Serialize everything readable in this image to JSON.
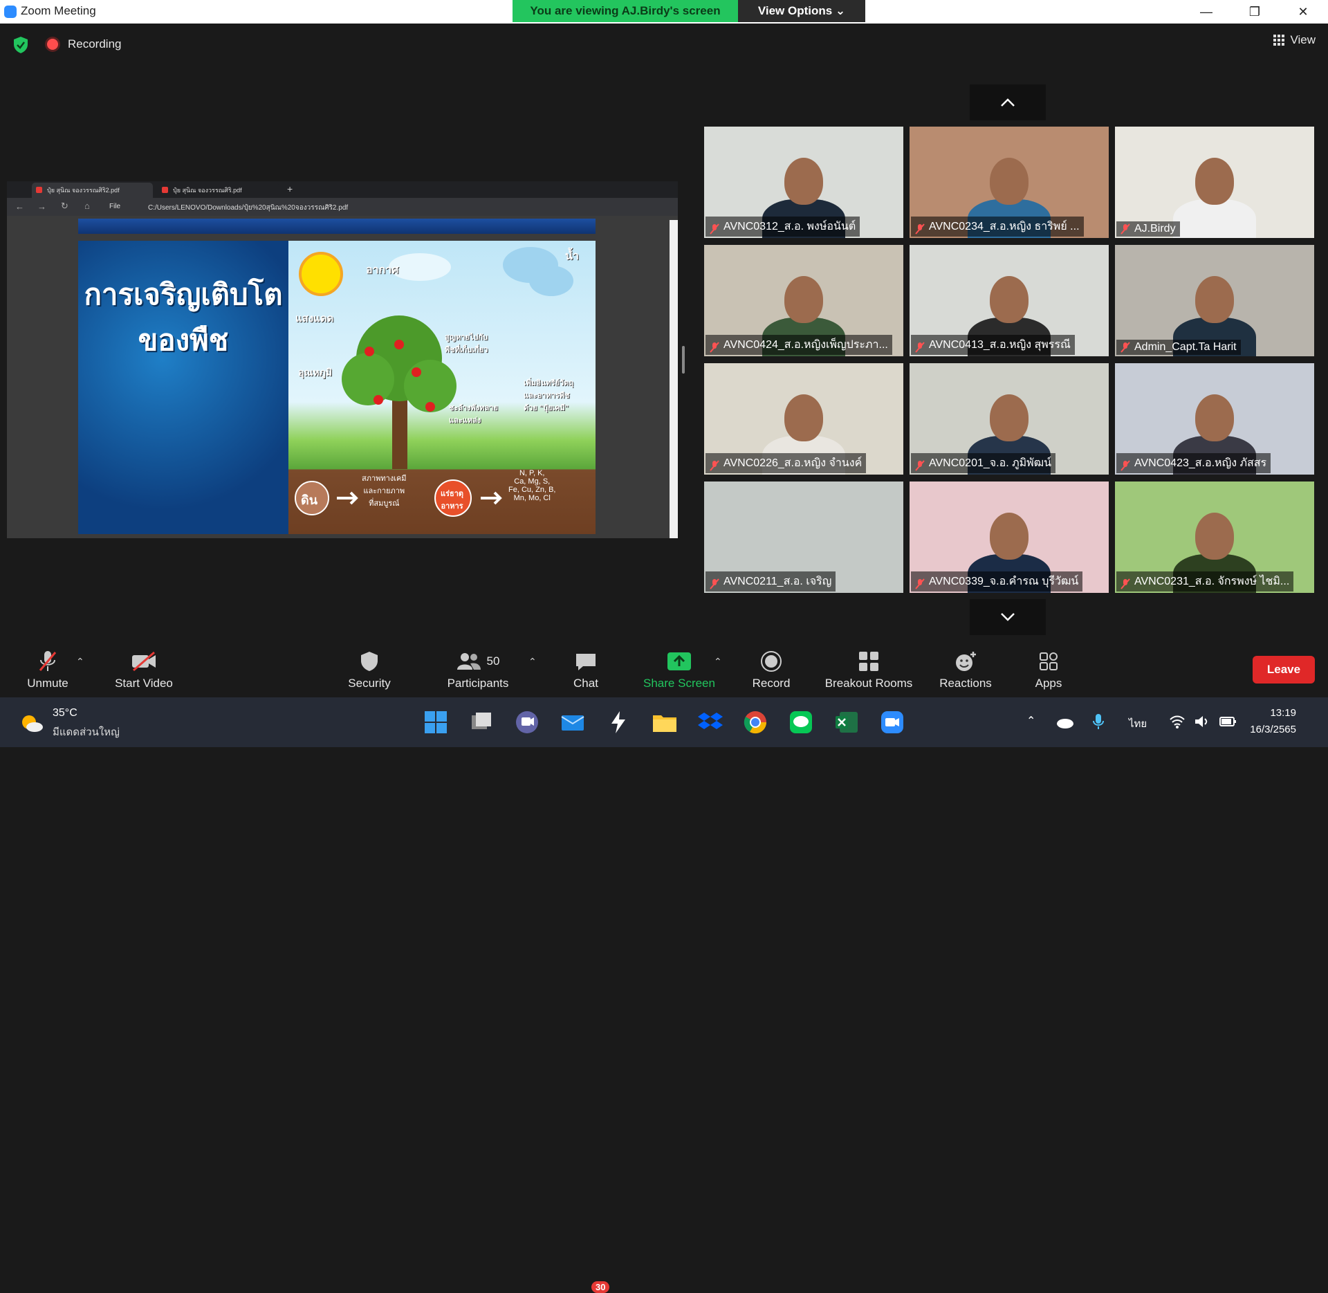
{
  "window": {
    "title": "Zoom Meeting",
    "banner": "You are viewing AJ.Birdy's screen",
    "view_options": "View Options ⌄",
    "minimize": "—",
    "restore": "❐",
    "close": "✕"
  },
  "status": {
    "recording": "Recording",
    "view": "View"
  },
  "share": {
    "tabs": [
      "ปุ๋ย สุนิณ จองวรรณศิริ2.pdf",
      "ปุ๋ย สุนิณ จองวรรณศิริ.pdf"
    ],
    "new_tab": "+",
    "address_label": "File",
    "address": "C:/Users/LENOVO/Downloads/ปุ๋ย%20สุนิณ%20จองวรรณศิริ2.pdf",
    "slide_title_line1": "การเจริญเติบโต",
    "slide_title_line2": "ของพืช",
    "labels": {
      "air": "อากาศ",
      "water": "น้ำ",
      "sunlight": "แสงแดด",
      "temperature": "อุณหภูมิ",
      "release": "สูญหายไปกับ\nพืชที่เก็บเกี่ยว",
      "fertilizer": "เพิ่มอินทรีย์วัตถุ\nและอาหารพืช\nด้วย \"ปุ๋ยเคมี\"",
      "erosion": "ชะล้างพังทลาย\nและแหล่ง",
      "soil": "ดิน",
      "soil_desc": "สภาพทางเคมี\nและกายภาพ\nที่สมบูรณ์",
      "nutrients": "แร่ธาตุ\nอาหาร",
      "elements": "N, P, K,\nCa, Mg, S,\nFe, Cu, Zn, B,\nMn, Mo, Cl"
    }
  },
  "participants": [
    {
      "name": "AVNC0312_ส.อ. พงษ์อนันต์",
      "bg": "#d9dcd8"
    },
    {
      "name": "AVNC0234_ส.อ.หญิง ธาริพย์ ...",
      "bg": "#b98c70"
    },
    {
      "name": "AJ.Birdy",
      "bg": "#e8e6df"
    },
    {
      "name": "AVNC0424_ส.อ.หญิงเพ็ญประภา...",
      "bg": "#c9c2b4"
    },
    {
      "name": "AVNC0413_ส.อ.หญิง สุพรรณี",
      "bg": "#d8dad6"
    },
    {
      "name": "Admin_Capt.Ta Harit",
      "bg": "#b8b4ac"
    },
    {
      "name": "AVNC0226_ส.อ.หญิง จำนงค์",
      "bg": "#dcd8cc"
    },
    {
      "name": "AVNC0201_จ.อ. ภูมิพัฒน์",
      "bg": "#cfd0c8"
    },
    {
      "name": "AVNC0423_ส.อ.หญิง ภัสสร",
      "bg": "#c7ccd6"
    },
    {
      "name": "AVNC0211_ส.อ. เจริญ",
      "bg": "#c4c9c6"
    },
    {
      "name": "AVNC0339_จ.อ.คำรณ บุรีวัฒน์",
      "bg": "#e8c8cc"
    },
    {
      "name": "AVNC0231_ส.อ. จักรพงษ์ ไชมิ...",
      "bg": "#9fc87a"
    }
  ],
  "toolbar": {
    "unmute": "Unmute",
    "start_video": "Start Video",
    "security": "Security",
    "participants": "Participants",
    "participants_count": "50",
    "chat": "Chat",
    "chat_badge": "30",
    "share_screen": "Share Screen",
    "record": "Record",
    "breakout": "Breakout Rooms",
    "reactions": "Reactions",
    "apps": "Apps",
    "leave": "Leave"
  },
  "taskbar": {
    "temperature": "35°C",
    "weather": "มีแดดส่วนใหญ่",
    "language": "ไทย",
    "time": "13:19",
    "date": "16/3/2565"
  },
  "colors": {
    "zoom_blue": "#2d8cff",
    "banner_green": "#23c55e",
    "leave_red": "#e02828",
    "share_green": "#22c55e"
  }
}
